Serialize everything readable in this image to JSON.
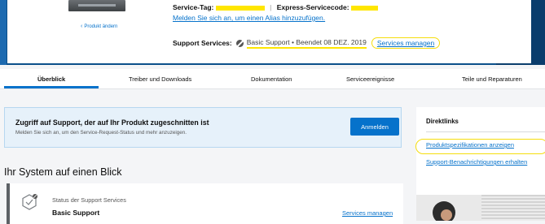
{
  "product": {
    "change_link": "Produkt ändern"
  },
  "info": {
    "service_tag_label": "Service-Tag:",
    "separator": "|",
    "express_code_label": "Express-Servicecode:",
    "alias_link": "Melden Sie sich an, um einen Alias hinzuzufügen.",
    "support_label": "Support Services:",
    "support_status": "Basic Support • Beendet 08 DEZ. 2019",
    "manage_link": "Services managen"
  },
  "tabs": [
    {
      "label": "Überblick",
      "active": true
    },
    {
      "label": "Treiber und Downloads",
      "active": false
    },
    {
      "label": "Dokumentation",
      "active": false
    },
    {
      "label": "Serviceereignisse",
      "active": false
    },
    {
      "label": "Teile und Reparaturen",
      "active": false
    }
  ],
  "signin": {
    "title": "Zugriff auf Support, der auf Ihr Produkt zugeschnitten ist",
    "subtitle": "Melden Sie sich an, um den Service-Request-Status und mehr anzuzeigen.",
    "button": "Anmelden"
  },
  "overview": {
    "heading": "Ihr System auf einen Blick",
    "status_label": "Status der Support Services",
    "status_value": "Basic Support",
    "manage_link": "Services managen"
  },
  "direct_links": {
    "title": "Direktlinks",
    "items": [
      "Produktspezifikationen anzeigen",
      "Support-Benachrichtigungen erhalten"
    ]
  },
  "colors": {
    "accent": "#0672cb",
    "highlight": "#ffe600"
  }
}
